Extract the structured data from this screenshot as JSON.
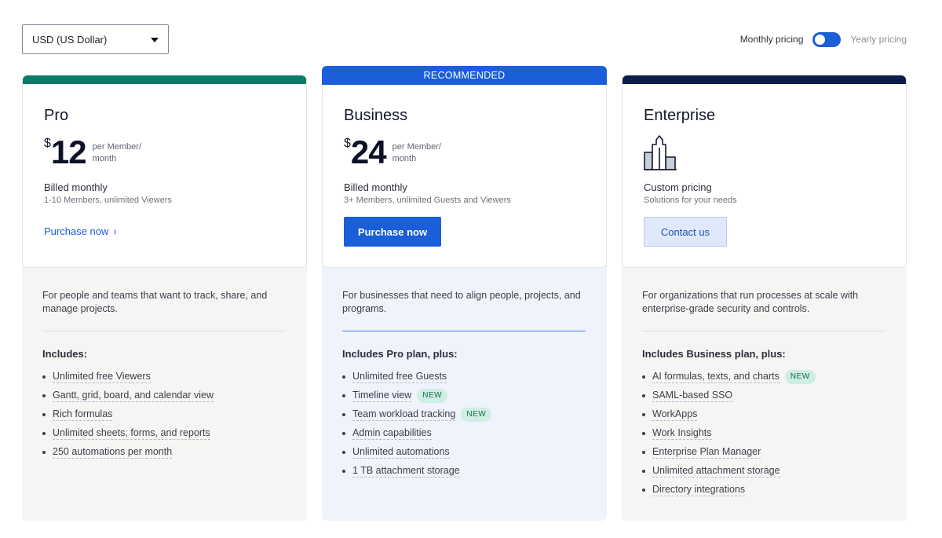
{
  "header": {
    "currency_value": "USD (US Dollar)",
    "toggle_left": "Monthly pricing",
    "toggle_right": "Yearly pricing"
  },
  "plans": [
    {
      "name": "Pro",
      "currency_symbol": "$",
      "price": "12",
      "per_line1": "per Member/",
      "per_line2": "month",
      "billed": "Billed monthly",
      "billed_sub": "1-10 Members, unlimited Viewers",
      "cta": "Purchase now",
      "cta_icon": "chevron-right-icon",
      "description": "For people and teams that want to track, share, and manage projects.",
      "includes_title": "Includes:",
      "features": [
        {
          "text": "Unlimited free Viewers"
        },
        {
          "text": "Gantt, grid, board, and calendar view"
        },
        {
          "text": "Rich formulas"
        },
        {
          "text": "Unlimited sheets, forms, and reports"
        },
        {
          "text": "250 automations per month"
        }
      ],
      "accent": "#0a7d6a"
    },
    {
      "name": "Business",
      "banner": "RECOMMENDED",
      "currency_symbol": "$",
      "price": "24",
      "per_line1": "per Member/",
      "per_line2": "month",
      "billed": "Billed monthly",
      "billed_sub": "3+ Members, unlimited Guests and Viewers",
      "cta": "Purchase now",
      "description": "For businesses that need to align people, projects, and programs.",
      "includes_title": "Includes Pro plan, plus:",
      "features": [
        {
          "text": "Unlimited free Guests"
        },
        {
          "text": "Timeline view",
          "badge": "NEW"
        },
        {
          "text": "Team workload tracking",
          "badge": "NEW"
        },
        {
          "text": "Admin capabilities"
        },
        {
          "text": "Unlimited automations"
        },
        {
          "text": "1 TB attachment storage"
        }
      ],
      "accent": "#1a5ed8"
    },
    {
      "name": "Enterprise",
      "icon": "building-icon",
      "billed": "Custom pricing",
      "billed_sub": "Solutions for your needs",
      "cta": "Contact us",
      "description": "For organizations that run processes at scale with enterprise-grade security and controls.",
      "includes_title": "Includes Business plan, plus:",
      "features": [
        {
          "text": "AI formulas, texts, and charts",
          "badge": "NEW"
        },
        {
          "text": "SAML-based SSO"
        },
        {
          "text": "WorkApps"
        },
        {
          "text": "Work Insights"
        },
        {
          "text": "Enterprise Plan Manager"
        },
        {
          "text": "Unlimited attachment storage"
        },
        {
          "text": "Directory integrations"
        }
      ],
      "accent": "#0c1d4a"
    }
  ]
}
